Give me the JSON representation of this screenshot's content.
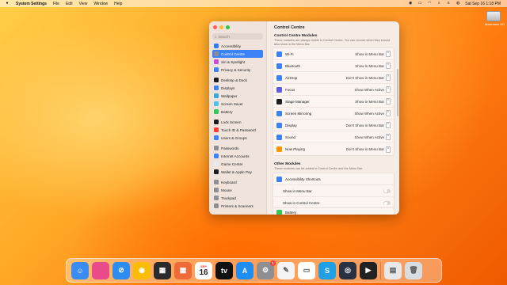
{
  "menubar": {
    "apple_icon": "apple-icon",
    "app_name": "System Settings",
    "menus": [
      "File",
      "Edit",
      "View",
      "Window",
      "Help"
    ],
    "datetime": "Sat Sep 16  1:18 PM"
  },
  "desktop": {
    "disk_label": "Macintosh HD"
  },
  "sidebar": {
    "search_placeholder": "Search",
    "items": [
      {
        "label": "Accessibility",
        "color": "#2f7cf6"
      },
      {
        "label": "Control Centre",
        "color": "#8e8e93",
        "selected": true
      },
      {
        "label": "Siri & Spotlight",
        "color": "#c94bd6"
      },
      {
        "label": "Privacy & Security",
        "color": "#3a82f6"
      },
      {
        "label": "Desktop & Dock",
        "color": "#1c1c1e"
      },
      {
        "label": "Displays",
        "color": "#3a82f6"
      },
      {
        "label": "Wallpaper",
        "color": "#35aadc"
      },
      {
        "label": "Screen Saver",
        "color": "#4cc2e8"
      },
      {
        "label": "Battery",
        "color": "#34c759"
      },
      {
        "label": "Lock Screen",
        "color": "#1c1c1e"
      },
      {
        "label": "Touch ID & Password",
        "color": "#ff3b30"
      },
      {
        "label": "Users & Groups",
        "color": "#3a82f6"
      },
      {
        "label": "Passwords",
        "color": "#8e8e93"
      },
      {
        "label": "Internet Accounts",
        "color": "#3a82f6"
      },
      {
        "label": "Game Center",
        "color": "#e9e9ee"
      },
      {
        "label": "Wallet & Apple Pay",
        "color": "#1c1c1e"
      },
      {
        "label": "Keyboard",
        "color": "#8e8e93"
      },
      {
        "label": "Mouse",
        "color": "#8e8e93"
      },
      {
        "label": "Trackpad",
        "color": "#8e8e93"
      },
      {
        "label": "Printers & Scanners",
        "color": "#8e8e93"
      }
    ]
  },
  "main": {
    "title": "Control Centre",
    "modules_title": "Control Centre Modules",
    "modules_desc": "These modules are always visible in Control Centre. You can choose when they should also show in the Menu Bar.",
    "modules": [
      {
        "label": "Wi-Fi",
        "value": "Show in Menu Bar",
        "color": "#3a82f6"
      },
      {
        "label": "Bluetooth",
        "value": "Show in Menu Bar",
        "color": "#3a82f6"
      },
      {
        "label": "AirDrop",
        "value": "Don't Show in Menu Bar",
        "color": "#3a82f6"
      },
      {
        "label": "Focus",
        "value": "Show When Active",
        "color": "#5e5ce6"
      },
      {
        "label": "Stage Manager",
        "value": "Show in Menu Bar",
        "color": "#1c1c1e"
      },
      {
        "label": "Screen Mirroring",
        "value": "Show When Active",
        "color": "#3a82f6"
      },
      {
        "label": "Display",
        "value": "Don't Show in Menu Bar",
        "color": "#3a82f6"
      },
      {
        "label": "Sound",
        "value": "Show When Active",
        "color": "#3a82f6"
      },
      {
        "label": "Now Playing",
        "value": "Don't Show in Menu Bar",
        "color": "#ff9500"
      }
    ],
    "other_title": "Other Modules",
    "other_desc": "These modules can be added to Control Centre and the Menu Bar.",
    "accessibility_shortcuts": "Accessibility Shortcuts",
    "show_in_menu_bar": "Show in Menu Bar",
    "show_in_control_centre": "Show in Control Centre",
    "battery": "Battery"
  },
  "dock": {
    "items": [
      {
        "name": "finder",
        "color": "#3b8cf2",
        "glyph": "☺"
      },
      {
        "name": "launchpad",
        "color": "#e94b8a",
        "glyph": ""
      },
      {
        "name": "safari",
        "color": "#2d8cf0",
        "glyph": "⊘"
      },
      {
        "name": "chrome",
        "color": "#fbbc05",
        "glyph": "◉"
      },
      {
        "name": "mission-control",
        "color": "#2b2b2b",
        "glyph": "▦"
      },
      {
        "name": "app-grid",
        "color": "#f06a38",
        "glyph": "▦"
      },
      {
        "name": "calendar",
        "month": "SEP",
        "day": "16"
      },
      {
        "name": "apple-tv",
        "color": "#111111",
        "glyph": "tv"
      },
      {
        "name": "app-store",
        "color": "#1e8ef5",
        "glyph": "A"
      },
      {
        "name": "system-settings",
        "color": "#8e8e93",
        "glyph": "⚙",
        "badge": "1"
      },
      {
        "name": "textedit",
        "color": "#f4f4f4",
        "glyph": "✎"
      },
      {
        "name": "preview",
        "color": "#ffffff",
        "glyph": "▭"
      },
      {
        "name": "skype",
        "color": "#1fa0e6",
        "glyph": "S"
      },
      {
        "name": "quicktime",
        "color": "#2a3140",
        "glyph": "◎"
      },
      {
        "name": "final-cut-pro",
        "color": "#222222",
        "glyph": "▶"
      },
      {
        "name": "archive",
        "color": "#e8e8e8",
        "glyph": "▤"
      },
      {
        "name": "trash",
        "color": "#d8dde2",
        "glyph": "🗑"
      }
    ]
  }
}
